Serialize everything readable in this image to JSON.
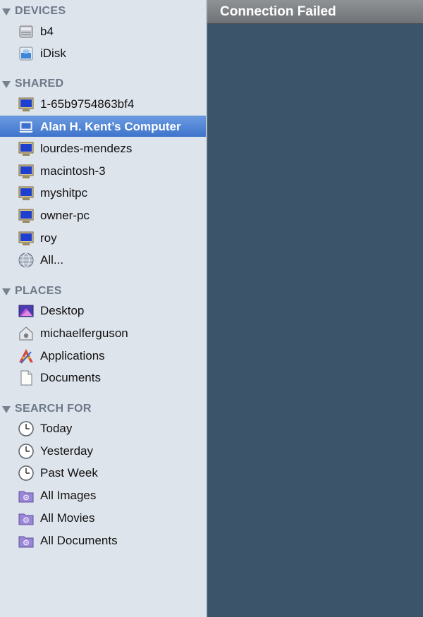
{
  "sidebar": {
    "devices": {
      "header": "DEVICES",
      "items": [
        {
          "label": "b4",
          "icon": "hard-drive-icon"
        },
        {
          "label": "iDisk",
          "icon": "idisk-icon"
        }
      ]
    },
    "shared": {
      "header": "SHARED",
      "items": [
        {
          "label": "1-65b9754863bf4",
          "icon": "pc-monitor-icon"
        },
        {
          "label": "Alan H. Kent’s Computer",
          "icon": "laptop-icon",
          "selected": true
        },
        {
          "label": "lourdes-mendezs",
          "icon": "pc-monitor-icon"
        },
        {
          "label": "macintosh-3",
          "icon": "pc-monitor-icon"
        },
        {
          "label": "myshitpc",
          "icon": "pc-monitor-icon"
        },
        {
          "label": "owner-pc",
          "icon": "pc-monitor-icon"
        },
        {
          "label": "roy",
          "icon": "pc-monitor-icon"
        },
        {
          "label": "All...",
          "icon": "globe-icon"
        }
      ]
    },
    "places": {
      "header": "PLACES",
      "items": [
        {
          "label": "Desktop",
          "icon": "desktop-icon"
        },
        {
          "label": "michaelferguson",
          "icon": "home-icon"
        },
        {
          "label": "Applications",
          "icon": "applications-icon"
        },
        {
          "label": "Documents",
          "icon": "document-icon"
        }
      ]
    },
    "search_for": {
      "header": "SEARCH FOR",
      "items": [
        {
          "label": "Today",
          "icon": "clock-icon"
        },
        {
          "label": "Yesterday",
          "icon": "clock-icon"
        },
        {
          "label": "Past Week",
          "icon": "clock-icon"
        },
        {
          "label": "All Images",
          "icon": "smart-folder-icon"
        },
        {
          "label": "All Movies",
          "icon": "smart-folder-icon"
        },
        {
          "label": "All Documents",
          "icon": "smart-folder-icon"
        }
      ]
    }
  },
  "main": {
    "header_title": "Connection Failed"
  },
  "colors": {
    "sidebar_bg": "#dee4ec",
    "selection": "#4a7fd2",
    "main_bg": "#3b5469",
    "header_text": "#6d7888"
  }
}
